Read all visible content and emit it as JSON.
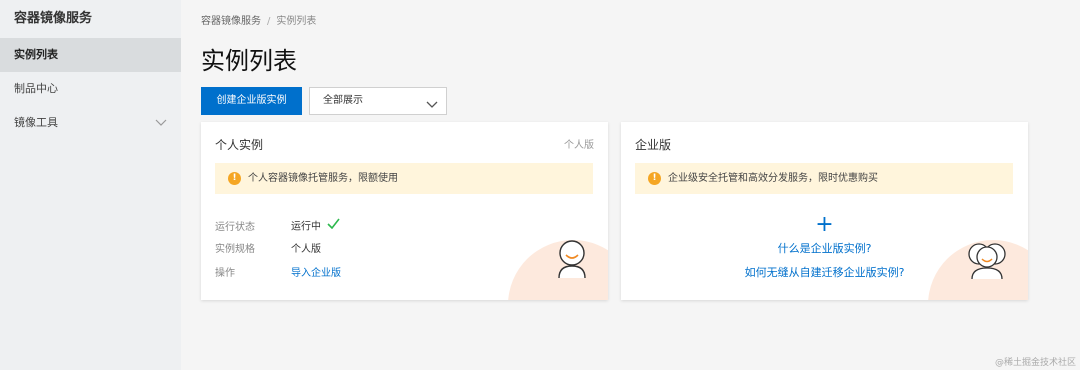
{
  "sidebar": {
    "title": "容器镜像服务",
    "items": [
      {
        "label": "实例列表",
        "active": true
      },
      {
        "label": "制品中心",
        "active": false
      },
      {
        "label": "镜像工具",
        "active": false,
        "expandable": true
      }
    ]
  },
  "breadcrumb": {
    "root": "容器镜像服务",
    "separator": "/",
    "current": "实例列表"
  },
  "page": {
    "title": "实例列表"
  },
  "toolbar": {
    "create_label": "创建企业版实例",
    "filter_value": "全部展示"
  },
  "personal_card": {
    "title": "个人实例",
    "tag": "个人版",
    "notice": "个人容器镜像托管服务，限额使用",
    "rows": [
      {
        "key": "运行状态",
        "value": "运行中"
      },
      {
        "key": "实例规格",
        "value": "个人版"
      },
      {
        "key": "操作",
        "value": "导入企业版"
      }
    ]
  },
  "enterprise_card": {
    "title": "企业版",
    "notice": "企业级安全托管和高效分发服务，限时优惠购买",
    "plus": "+",
    "link1": "什么是企业版实例?",
    "link2": "如何无缝从自建迁移企业版实例?"
  },
  "watermark": "@稀土掘金技术社区",
  "colors": {
    "accent": "#0070cc",
    "warning": "#f5a623",
    "notice_bg": "#fff5dc",
    "success": "#2db84d"
  },
  "icons": {
    "warning": "warning-icon",
    "check": "check-icon",
    "chevron": "chevron-down-icon",
    "avatar_single": "user-avatar-icon",
    "avatar_group": "users-group-icon"
  }
}
